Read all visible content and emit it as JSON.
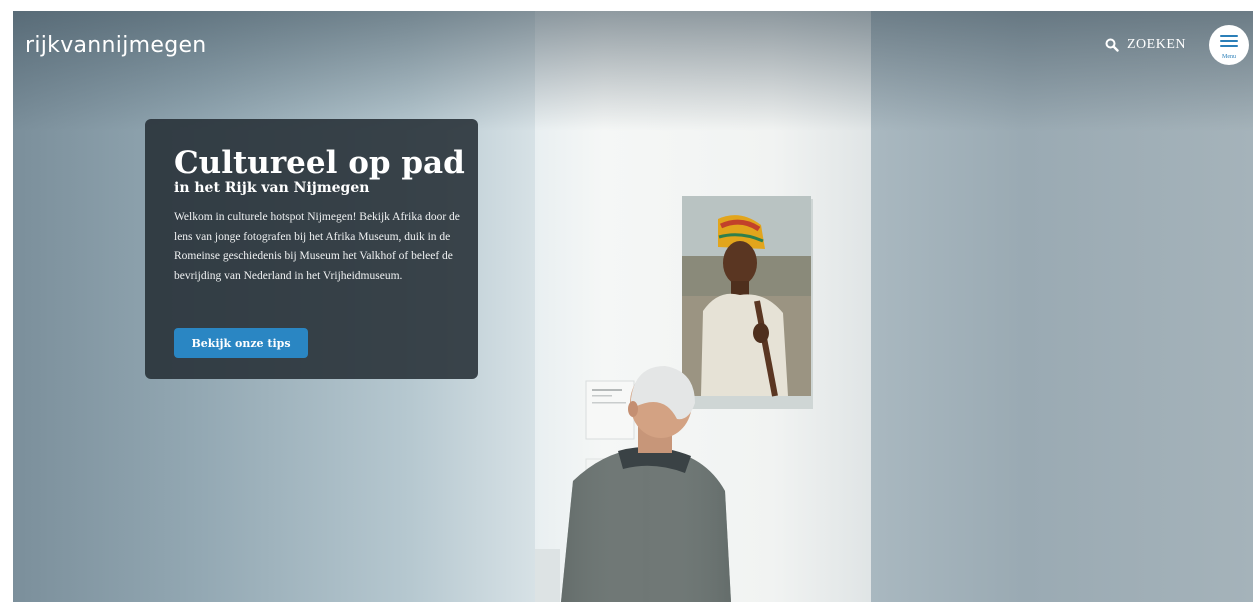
{
  "header": {
    "logo_text": "rijkvannijmegen",
    "search_label": "ZOEKEN",
    "menu_label": "Menu"
  },
  "hero": {
    "title": "Cultureel op pad",
    "subtitle": "in het Rijk van Nijmegen",
    "body": "Welkom in culturele hotspot Nijmegen! Bekijk Afrika door de lens van jonge fotografen bij het Afrika Museum, duik in de Romeinse geschiedenis bij Museum het Valkhof of beleef de bevrijding van Nederland in het Vrijheidmuseum.",
    "cta_label": "Bekijk onze tips"
  },
  "colors": {
    "accent": "#2a86c3",
    "card_background": "#262f36",
    "header_text": "#ffffff"
  },
  "icons": {
    "search": "search-icon",
    "menu": "hamburger-menu-icon"
  }
}
